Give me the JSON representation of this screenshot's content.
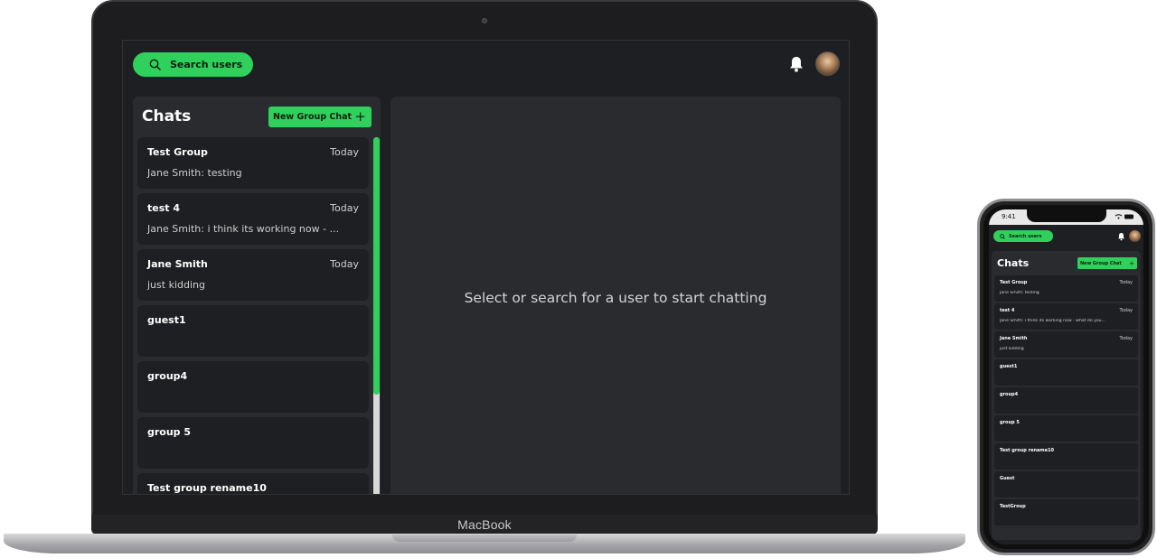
{
  "laptop": {
    "brand": "MacBook",
    "search": {
      "label": "Search users",
      "icon": "search-icon"
    },
    "header_icons": [
      "bell-icon",
      "avatar"
    ],
    "sidebar": {
      "title": "Chats",
      "new_group_label": "New Group Chat",
      "new_group_icon": "plus-icon",
      "chats": [
        {
          "name": "Test Group",
          "time": "Today",
          "message": "Jane Smith: testing"
        },
        {
          "name": "test 4",
          "time": "Today",
          "message": "Jane Smith: i think its working now - ..."
        },
        {
          "name": "Jane Smith",
          "time": "Today",
          "message": "just kidding"
        },
        {
          "name": "guest1",
          "time": "",
          "message": ""
        },
        {
          "name": "group4",
          "time": "",
          "message": ""
        },
        {
          "name": "group 5",
          "time": "",
          "message": ""
        },
        {
          "name": "Test group rename10",
          "time": "",
          "message": ""
        }
      ]
    },
    "main": {
      "placeholder": "Select or search for a user to start chatting"
    }
  },
  "phone": {
    "status_time": "9:41",
    "search": {
      "label": "Search users"
    },
    "sidebar": {
      "title": "Chats",
      "new_group_label": "New Group Chat",
      "chats": [
        {
          "name": "Test Group",
          "time": "Today",
          "message": "Jane Smith: testing"
        },
        {
          "name": "test 4",
          "time": "Today",
          "message": "Jane Smith: i think its working now - what do you..."
        },
        {
          "name": "Jane Smith",
          "time": "Today",
          "message": "just kidding"
        },
        {
          "name": "guest1",
          "time": "",
          "message": ""
        },
        {
          "name": "group4",
          "time": "",
          "message": ""
        },
        {
          "name": "group 5",
          "time": "",
          "message": ""
        },
        {
          "name": "Test group rename10",
          "time": "",
          "message": ""
        },
        {
          "name": "Guest",
          "time": "",
          "message": ""
        },
        {
          "name": "TestGroup",
          "time": "",
          "message": ""
        }
      ]
    }
  },
  "colors": {
    "accent": "#2fd05c",
    "panel": "#2a2b2f",
    "background": "#1e1f22"
  }
}
